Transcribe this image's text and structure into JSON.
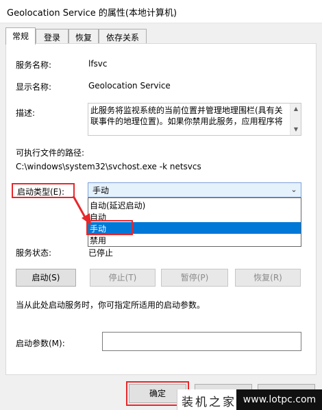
{
  "window": {
    "title": "Geolocation Service 的属性(本地计算机)"
  },
  "tabs": [
    {
      "label": "常规"
    },
    {
      "label": "登录"
    },
    {
      "label": "恢复"
    },
    {
      "label": "依存关系"
    }
  ],
  "general": {
    "service_name_label": "服务名称:",
    "service_name": "lfsvc",
    "display_name_label": "显示名称:",
    "display_name": "Geolocation Service",
    "description_label": "描述:",
    "description": "此服务将监视系统的当前位置并管理地理围栏(具有关联事件的地理位置)。如果你禁用此服务，应用程序将",
    "exe_path_label": "可执行文件的路径:",
    "exe_path": "C:\\windows\\system32\\svchost.exe -k netsvcs",
    "startup_type_label": "启动类型(E):",
    "startup_type_value": "手动",
    "startup_options": [
      {
        "label": "自动(延迟启动)"
      },
      {
        "label": "自动"
      },
      {
        "label": "手动"
      },
      {
        "label": "禁用"
      }
    ],
    "status_label": "服务状态:",
    "status_value": "已停止",
    "buttons": {
      "start": "启动(S)",
      "stop": "停止(T)",
      "pause": "暂停(P)",
      "resume": "恢复(R)"
    },
    "hint": "当从此处启动服务时，你可指定所适用的启动参数。",
    "param_label": "启动参数(M):"
  },
  "footer": {
    "ok": "确定"
  },
  "watermark": {
    "cn": "装机之家",
    "url": "www.lotpc.com"
  },
  "colors": {
    "highlight": "#e8262a",
    "selection": "#0078d7"
  }
}
